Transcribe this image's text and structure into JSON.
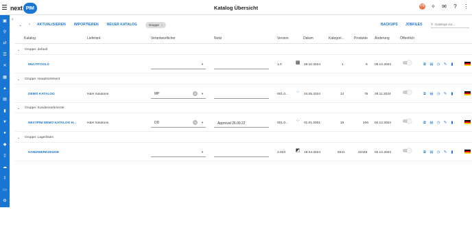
{
  "app": {
    "logo_prefix": "next",
    "logo_suffix": "PIM",
    "page_title": "Katalog Übersicht",
    "user_badge": "PB"
  },
  "toolbar": {
    "refresh": "AKTUALISIEREN",
    "import": "IMPORTIEREN",
    "new_catalog": "NEUER KATALOG",
    "group_chip": "Gruppe",
    "backups": "BACKUPS",
    "jobfiles": "JOBFILES",
    "search_placeholder": "Kataloge sur..."
  },
  "table": {
    "columns": [
      "Katalog",
      "Lieferant",
      "Verantwortlicher",
      "Notiz",
      "Version",
      "Datum",
      "Kategori...",
      "Produkte",
      "Änderung",
      "Öffentlich"
    ],
    "groups": [
      {
        "label": "Gruppe: default",
        "rows": [
          {
            "name": "MULTITOOLS",
            "supplier": "",
            "owner": "",
            "note": "",
            "version": "1.0",
            "thumb": "image",
            "date": "29.10.2024",
            "categories": "1",
            "products": "6",
            "changed": "09.12.2024"
          }
        ]
      },
      {
        "label": "Gruppe: Hauptsortiment",
        "rows": [
          {
            "name": "DEMO KATALOG",
            "supplier": "H&H Solutions",
            "owner": "MP",
            "note": "",
            "version": "001.0...",
            "thumb": "dots",
            "date": "24.05.2024",
            "categories": "14",
            "products": "75",
            "changed": "28.11.2024"
          }
        ]
      },
      {
        "label": "Gruppe: Kundensortimente",
        "rows": [
          {
            "name": "NEXTPIM DEMO KATALOG H...",
            "supplier": "H&H Solutions",
            "owner": "DD",
            "note": "Approval 26.09.22",
            "version": "001.0...",
            "thumb": "dots",
            "date": "01.01.0001",
            "categories": "19",
            "products": "106",
            "changed": "02.12.2024"
          }
        ]
      },
      {
        "label": "Gruppe: Lagerlisten",
        "rows": [
          {
            "name": "HANDWERKZEUGE",
            "supplier": "",
            "owner": "",
            "note": "",
            "version": "2.023",
            "thumb": "chart",
            "date": "18.04.2024",
            "categories": "6341",
            "products": "22446",
            "changed": "02.12.2024"
          }
        ]
      }
    ]
  },
  "colors": {
    "primary": "#1976d2",
    "flag_black": "#000000",
    "flag_red": "#dd0000",
    "flag_gold": "#ffce00"
  }
}
